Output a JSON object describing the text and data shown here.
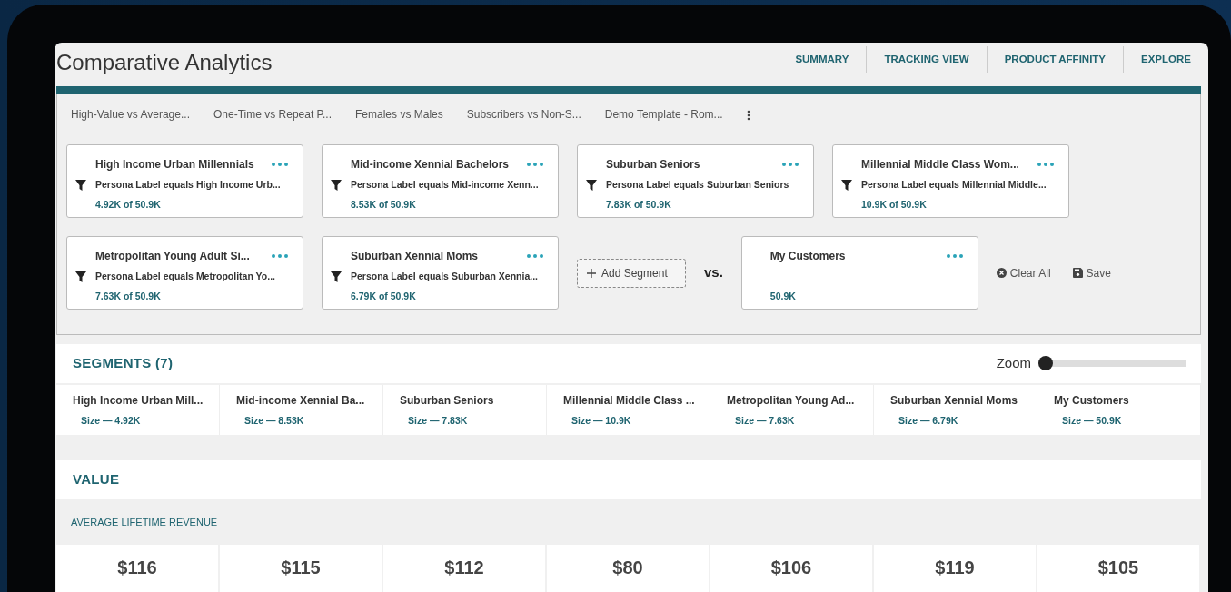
{
  "title": "Comparative Analytics",
  "nav_tabs": [
    {
      "label": "SUMMARY",
      "selected": true
    },
    {
      "label": "TRACKING VIEW",
      "selected": false
    },
    {
      "label": "PRODUCT AFFINITY",
      "selected": false
    },
    {
      "label": "EXPLORE",
      "selected": false
    }
  ],
  "templates": [
    "High-Value vs Average...",
    "One-Time vs Repeat P...",
    "Females vs Males",
    "Subscribers vs Non-S...",
    "Demo Template - Rom..."
  ],
  "segment_cards": [
    {
      "name": "High Income Urban Millennials",
      "filter": "Persona Label equals High Income Urb...",
      "count": "4.92K of 50.9K"
    },
    {
      "name": "Mid-income Xennial Bachelors",
      "filter": "Persona Label equals Mid-income Xenn...",
      "count": "8.53K of 50.9K"
    },
    {
      "name": "Suburban Seniors",
      "filter": "Persona Label equals Suburban Seniors",
      "count": "7.83K of 50.9K"
    },
    {
      "name": "Millennial Middle Class Wom...",
      "filter": "Persona Label equals Millennial Middle...",
      "count": "10.9K of 50.9K"
    },
    {
      "name": "Metropolitan Young Adult Si...",
      "filter": "Persona Label equals Metropolitan Yo...",
      "count": "7.63K of 50.9K"
    },
    {
      "name": "Suburban Xennial Moms",
      "filter": "Persona Label equals Suburban Xennia...",
      "count": "6.79K of 50.9K"
    }
  ],
  "add_segment": "Add Segment",
  "vs_label": "vs.",
  "comparison_card": {
    "name": "My Customers",
    "count": "50.9K"
  },
  "actions": [
    {
      "kind": "clear",
      "label": "Clear All"
    },
    {
      "kind": "save",
      "label": "Save"
    }
  ],
  "segments_panel": {
    "title": "SEGMENTS (7)",
    "zoom": {
      "label": "Zoom",
      "level": 0
    },
    "items": [
      {
        "name": "High Income Urban Mill...",
        "size": "Size — 4.92K"
      },
      {
        "name": "Mid-income Xennial Ba...",
        "size": "Size — 8.53K"
      },
      {
        "name": "Suburban Seniors",
        "size": "Size — 7.83K"
      },
      {
        "name": "Millennial Middle Class ...",
        "size": "Size — 10.9K"
      },
      {
        "name": "Metropolitan Young Ad...",
        "size": "Size — 7.63K"
      },
      {
        "name": "Suburban Xennial Moms",
        "size": "Size — 6.79K"
      },
      {
        "name": "My Customers",
        "size": "Size — 50.9K"
      }
    ]
  },
  "value_section": {
    "title": "VALUE",
    "metric": "AVERAGE LIFETIME REVENUE",
    "values": [
      "$116",
      "$115",
      "$112",
      "$80",
      "$106",
      "$119",
      "$105"
    ]
  }
}
